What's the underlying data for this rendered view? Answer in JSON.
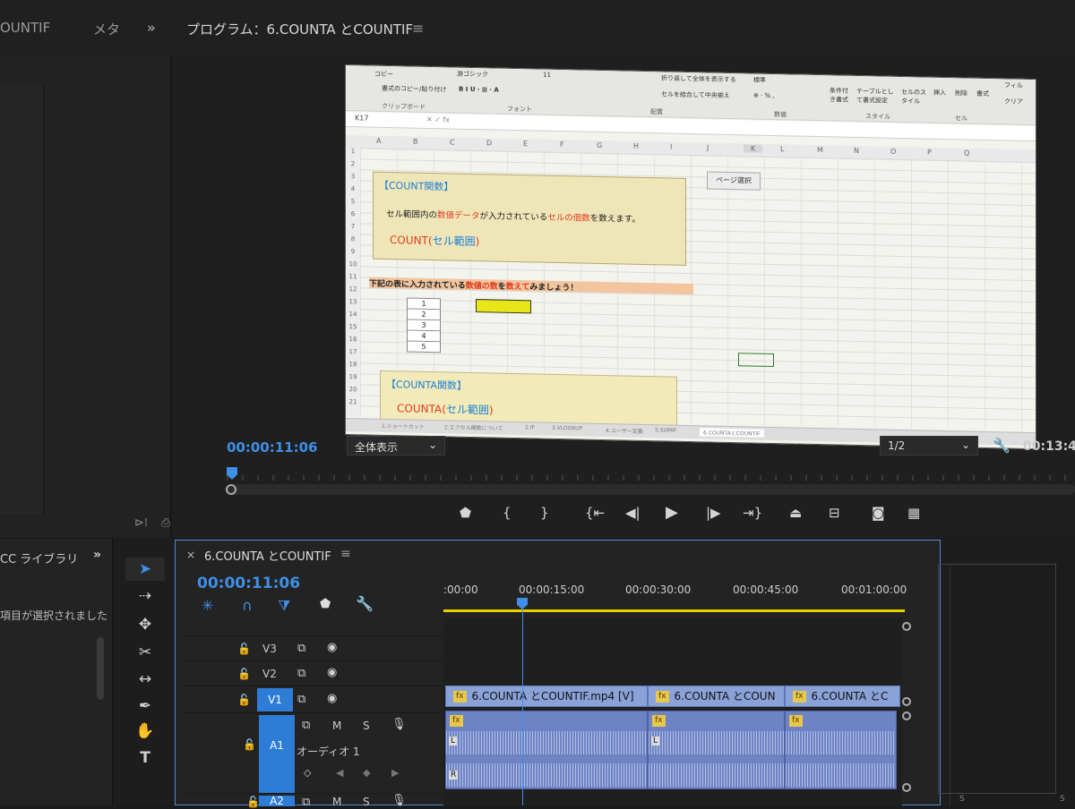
{
  "top_bar": {
    "left_tab_fragment": "OUNTIF",
    "meta_tab": "メタ",
    "overflow_icon": "chevrons-right-icon",
    "program_title": "プログラム：6.COUNTA とCOUNTIF",
    "menu_icon": "hamburger-icon"
  },
  "spreadsheet": {
    "cell_ref": "K17",
    "ribbon": {
      "font_name": "游ゴシック",
      "font_size": "11",
      "wrap_text": "折り返して全体を表示する",
      "merge_center": "セルを結合して中央揃え",
      "number_format": "標準",
      "clipboard_label": "クリップボード",
      "font_label": "フォント",
      "alignment_label": "配置",
      "number_label": "数値",
      "style_label": "スタイル",
      "cells_label": "セル",
      "copy": "コピー",
      "format_painter": "書式のコピー/貼り付け",
      "conditional": "条件付き書式",
      "table_format": "テーブルとして書式設定",
      "cell_style": "セルのスタイル",
      "insert": "挿入",
      "delete": "削除",
      "format": "書式",
      "fill": "フィル",
      "clear": "クリア"
    },
    "columns": [
      "A",
      "B",
      "C",
      "D",
      "E",
      "F",
      "G",
      "H",
      "I",
      "J",
      "K",
      "L",
      "M",
      "N",
      "O",
      "P",
      "Q"
    ],
    "rows": [
      "1",
      "2",
      "3",
      "4",
      "5",
      "6",
      "7",
      "8",
      "9",
      "10",
      "11",
      "12",
      "13",
      "14",
      "15",
      "16",
      "17",
      "18",
      "19",
      "20",
      "21"
    ],
    "count_box": {
      "title": "【COUNT関数】",
      "desc_prefix": "セル範囲内の",
      "desc_red1": "数値データ",
      "desc_mid": "が入力されている",
      "desc_red2": "セルの個数",
      "desc_suffix": "を数えます。",
      "formula_fn": "COUNT(",
      "formula_arg": "セル範囲",
      "formula_end": ")"
    },
    "page_button": "ページ選択",
    "instruction": {
      "prefix": "下記の表に入力されている",
      "red1": "数値の数",
      "mid": "を",
      "red2": "数えて",
      "suffix": "みましょう！"
    },
    "table_values": [
      "1",
      "2",
      "3",
      "4",
      "5"
    ],
    "counta_box": {
      "title": "【COUNTA関数】",
      "formula_fn": "COUNTA(",
      "formula_arg": "セル範囲",
      "formula_end": ")"
    },
    "sheet_tabs": [
      "1.ショートカット",
      "2.エクセル関数について",
      "2.IF",
      "3.VLOOKUP",
      "4.ユーザー定義",
      "5.SUMIF",
      "6.COUNTAとCOUNTIF"
    ]
  },
  "monitor_controls": {
    "timecode": "00:00:11:06",
    "fit_dropdown": "全体表示",
    "resolution_dropdown": "1/2",
    "duration": "00:13:4",
    "transport_icons": [
      "marker-icon",
      "in-point-icon",
      "out-point-icon",
      "go-to-in-icon",
      "step-back-icon",
      "play-icon",
      "step-forward-icon",
      "go-to-out-icon",
      "lift-icon",
      "extract-icon",
      "camera-icon",
      "multi-camera-icon"
    ]
  },
  "library_panel": {
    "title": "CC ライブラリ",
    "status": "項目が選択されました"
  },
  "tools": [
    "selection-tool-icon",
    "track-select-icon",
    "ripple-edit-icon",
    "razor-icon",
    "slip-icon",
    "pen-icon",
    "hand-icon",
    "type-icon"
  ],
  "timeline": {
    "sequence_name": "6.COUNTA とCOUNTIF",
    "timecode": "00:00:11:06",
    "ruler_labels": [
      ":00:00",
      "00:00:15:00",
      "00:00:30:00",
      "00:00:45:00",
      "00:01:00:00"
    ],
    "tracks": {
      "v3": "V3",
      "v2": "V2",
      "v1": "V1",
      "a1": "A1",
      "a1_name": "オーディオ 1",
      "a2": "A2",
      "m": "M",
      "s": "S"
    },
    "clips": [
      "6.COUNTA とCOUNTIF.mp4 [V]",
      "6.COUNTA とCOUN",
      "6.COUNTA とC"
    ],
    "fx": "fx",
    "channel_l": "L",
    "channel_r": "R",
    "right_s": "S"
  }
}
